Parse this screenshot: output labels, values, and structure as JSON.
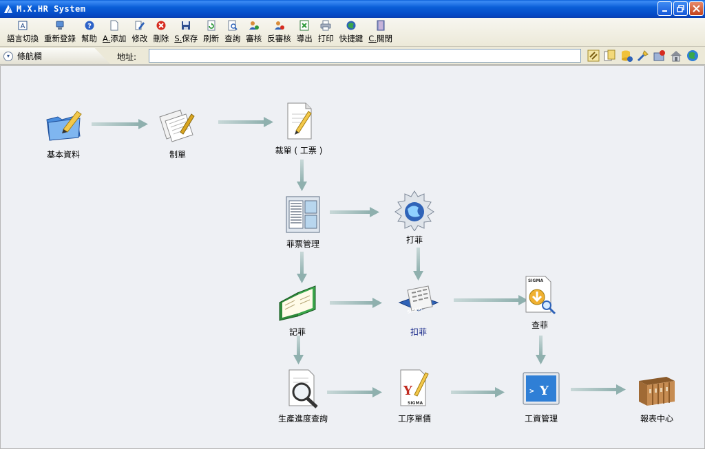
{
  "window": {
    "title": "M.X.HR System"
  },
  "toolbar": {
    "items": [
      {
        "label": "語言切換",
        "accel": "",
        "icon": "language-icon"
      },
      {
        "label": "重新登錄",
        "accel": "",
        "icon": "relogin-icon"
      },
      {
        "label": "幫助",
        "accel": "",
        "icon": "help-icon"
      },
      {
        "label": "添加",
        "accel": "A.",
        "icon": "add-icon"
      },
      {
        "label": "修改",
        "accel": "",
        "icon": "edit-icon"
      },
      {
        "label": "刪除",
        "accel": "",
        "icon": "delete-icon"
      },
      {
        "label": "保存",
        "accel": "S.",
        "icon": "save-icon"
      },
      {
        "label": "刷新",
        "accel": "",
        "icon": "refresh-icon"
      },
      {
        "label": "查詢",
        "accel": "",
        "icon": "query-icon"
      },
      {
        "label": "審核",
        "accel": "",
        "icon": "approve-icon"
      },
      {
        "label": "反審核",
        "accel": "",
        "icon": "unapprove-icon"
      },
      {
        "label": "導出",
        "accel": "",
        "icon": "export-icon"
      },
      {
        "label": "打印",
        "accel": "",
        "icon": "print-icon"
      },
      {
        "label": "快捷鍵",
        "accel": "",
        "icon": "shortcut-icon"
      },
      {
        "label": "關閉",
        "accel": "C.",
        "icon": "close-door-icon"
      }
    ]
  },
  "addressbar": {
    "nav_tab_label": "條航欄",
    "address_label": "地址:",
    "address_value": ""
  },
  "flow": {
    "nodes": {
      "basic_data": "基本資料",
      "make_order": "制單",
      "cutting_order": "裁單 ( 工票 )",
      "ticket_mgmt": "菲票管理",
      "print_ticket": "打菲",
      "record_ticket": "記菲",
      "deduct_ticket": "扣菲",
      "check_ticket": "查菲",
      "progress_query": "生產進度查詢",
      "process_price": "工序單價",
      "wage_mgmt": "工資管理",
      "report_center": "報表中心"
    }
  }
}
